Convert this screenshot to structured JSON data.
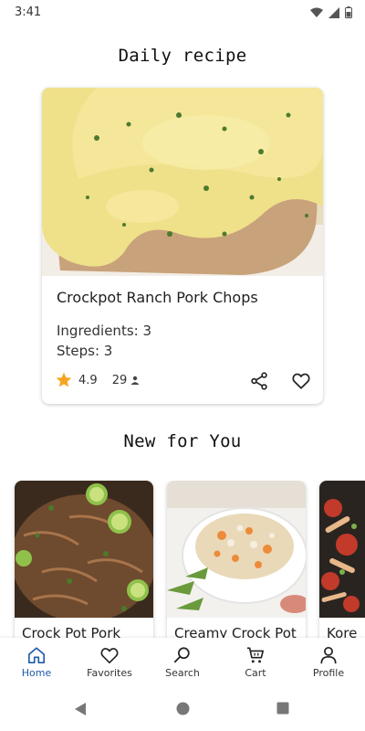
{
  "status_bar": {
    "time": "3:41",
    "icons": [
      "wifi-icon",
      "signal-icon",
      "battery-icon"
    ]
  },
  "daily": {
    "section_title": "Daily recipe",
    "recipe": {
      "name": "Crockpot Ranch Pork Chops",
      "ingredients_label": "Ingredients: 3",
      "steps_label": "Steps: 3",
      "rating": "4.9",
      "reviews": "29",
      "image": "pork-chops-with-ranch-gravy-photo"
    }
  },
  "new_for_you": {
    "section_title": "New for You",
    "items": [
      {
        "title": "Crock Pot Pork",
        "image": "shredded-pork-with-lime-photo"
      },
      {
        "title": "Creamy Crock Pot",
        "image": "creamy-risotto-bowl-photo"
      },
      {
        "title": "Kore",
        "image": "korean-dish-photo"
      }
    ]
  },
  "bottom_nav": {
    "items": [
      {
        "label": "Home",
        "icon": "home-icon",
        "active": true
      },
      {
        "label": "Favorites",
        "icon": "heart-icon",
        "active": false
      },
      {
        "label": "Search",
        "icon": "search-icon",
        "active": false
      },
      {
        "label": "Cart",
        "icon": "cart-icon",
        "active": false
      },
      {
        "label": "Profile",
        "icon": "person-icon",
        "active": false
      }
    ]
  },
  "colors": {
    "accent": "#1e5aa8",
    "star": "#f5a623"
  }
}
